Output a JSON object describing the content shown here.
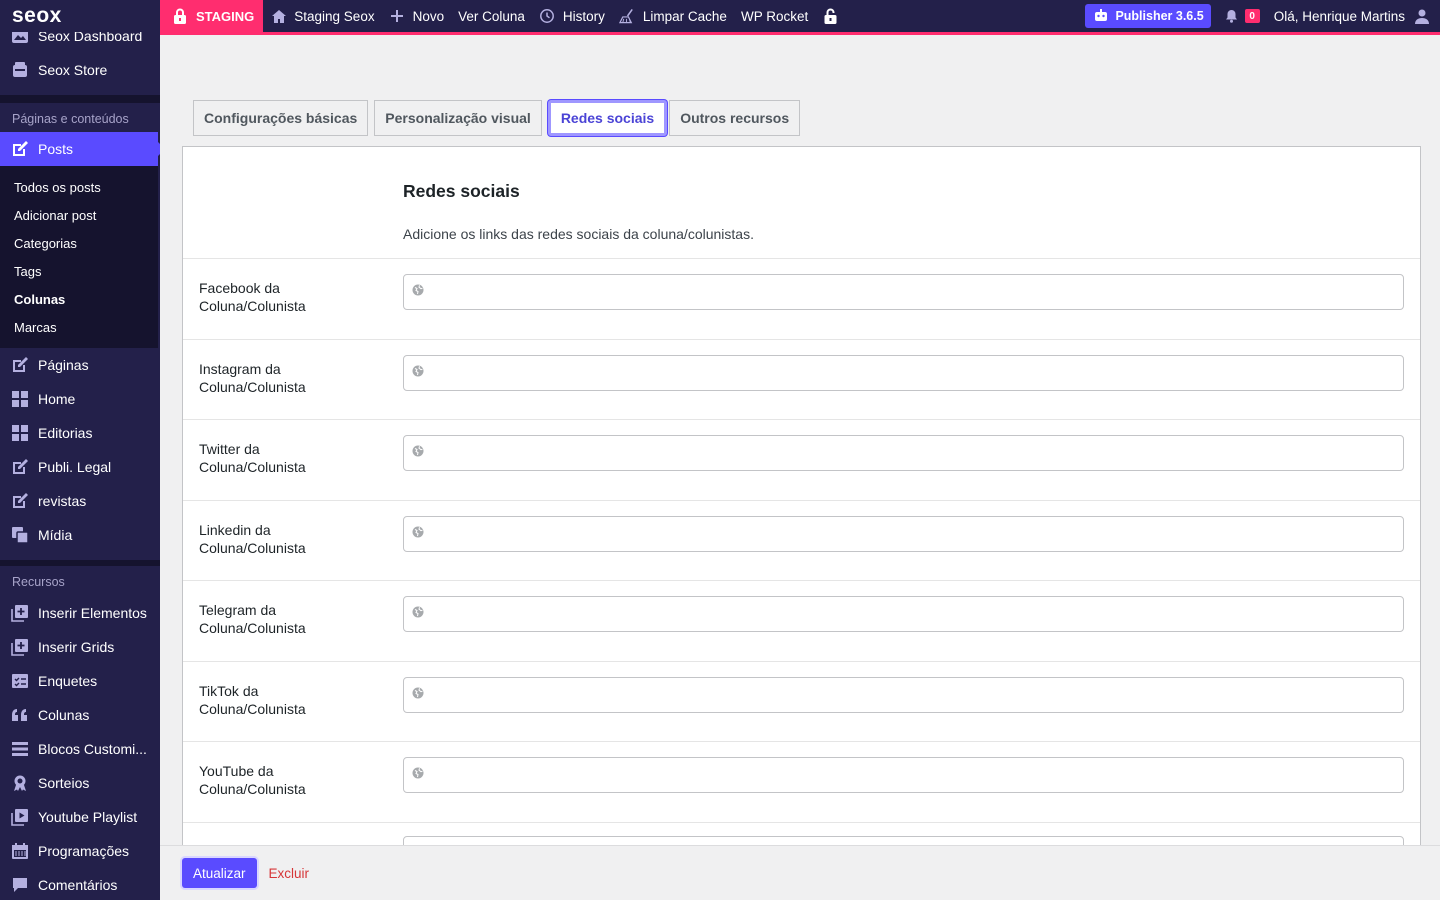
{
  "topbar": {
    "logo": "seox",
    "staging_label": "STAGING",
    "site_name": "Staging Seox",
    "new_label": "Novo",
    "view_label": "Ver Coluna",
    "history_label": "History",
    "cache_label": "Limpar Cache",
    "rocket_label": "WP Rocket",
    "publisher_label": "Publisher 3.6.5",
    "notification_count": "0",
    "greeting": "Olá, Henrique Martins",
    "colors": {
      "bar": "#23204a",
      "accent": "#ff2d6f",
      "brand": "#5a4bff"
    }
  },
  "sidebar": {
    "top_items": [
      {
        "label": "Seox Dashboard",
        "icon": "dashboard-icon"
      },
      {
        "label": "Seox Store",
        "icon": "store-icon"
      }
    ],
    "section_pages": "Páginas e conteúdos",
    "posts_label": "Posts",
    "posts_submenu": [
      "Todos os posts",
      "Adicionar post",
      "Categorias",
      "Tags",
      "Colunas",
      "Marcas"
    ],
    "posts_submenu_current": "Colunas",
    "content_items": [
      {
        "label": "Páginas",
        "icon": "edit-icon"
      },
      {
        "label": "Home",
        "icon": "grid-icon"
      },
      {
        "label": "Editorias",
        "icon": "grid-icon"
      },
      {
        "label": "Publi. Legal",
        "icon": "edit-icon"
      },
      {
        "label": "revistas",
        "icon": "edit-icon"
      },
      {
        "label": "Mídia",
        "icon": "media-icon"
      }
    ],
    "section_resources": "Recursos",
    "resource_items": [
      {
        "label": "Inserir Elementos",
        "icon": "plus-box-icon"
      },
      {
        "label": "Inserir Grids",
        "icon": "plus-box-icon"
      },
      {
        "label": "Enquetes",
        "icon": "poll-icon"
      },
      {
        "label": "Colunas",
        "icon": "quote-icon"
      },
      {
        "label": "Blocos Customi...",
        "icon": "blocks-icon"
      },
      {
        "label": "Sorteios",
        "icon": "award-icon"
      },
      {
        "label": "Youtube Playlist",
        "icon": "playlist-icon"
      },
      {
        "label": "Programações",
        "icon": "calendar-icon"
      },
      {
        "label": "Comentários",
        "icon": "comment-icon"
      }
    ]
  },
  "tabs": {
    "basic": "Configurações básicas",
    "visual": "Personalização visual",
    "social": "Redes sociais",
    "other": "Outros recursos",
    "active": "social"
  },
  "panel": {
    "title": "Redes sociais",
    "description": "Adicione os links das redes sociais da coluna/colunistas.",
    "fields": [
      {
        "label": "Facebook da Coluna/Colunista",
        "value": ""
      },
      {
        "label": "Instagram da Coluna/Colunista",
        "value": ""
      },
      {
        "label": "Twitter da Coluna/Colunista",
        "value": ""
      },
      {
        "label": "Linkedin da Coluna/Colunista",
        "value": ""
      },
      {
        "label": "Telegram da Coluna/Colunista",
        "value": ""
      },
      {
        "label": "TikTok da Coluna/Colunista",
        "value": ""
      },
      {
        "label": "YouTube da Coluna/Colunista",
        "value": ""
      }
    ]
  },
  "footer": {
    "update_label": "Atualizar",
    "delete_label": "Excluir"
  }
}
